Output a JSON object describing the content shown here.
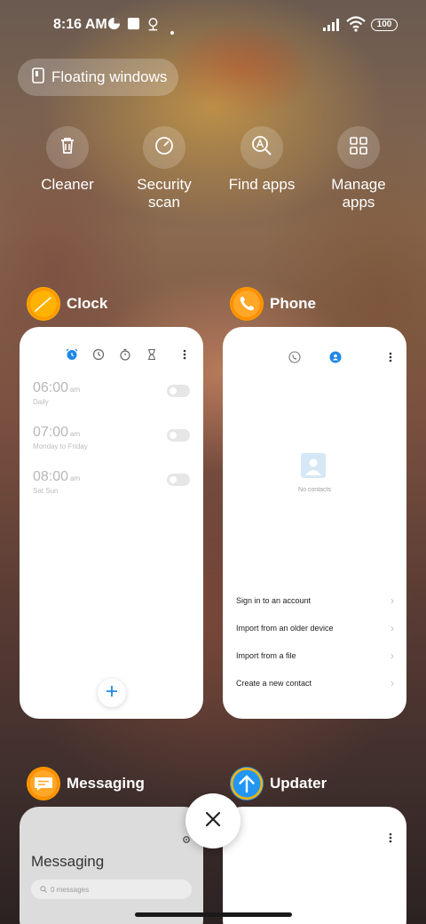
{
  "status_bar": {
    "time": "8:16 AM",
    "battery": "100"
  },
  "floating_windows": {
    "label": "Floating windows",
    "icon": "floating-window-icon"
  },
  "quick_actions": [
    {
      "label": "Cleaner",
      "icon": "trash-icon"
    },
    {
      "label": "Security scan",
      "icon": "security-scan-icon"
    },
    {
      "label": "Find apps",
      "icon": "find-apps-icon"
    },
    {
      "label": "Manage apps",
      "icon": "grid-icon"
    }
  ],
  "recent_apps": [
    {
      "name": "Clock",
      "icon_color": "#ffb300",
      "alarms": [
        {
          "time": "06:00",
          "ampm": "am",
          "repeat": "Daily",
          "enabled": false
        },
        {
          "time": "07:00",
          "ampm": "am",
          "repeat": "Monday to Friday",
          "enabled": false
        },
        {
          "time": "08:00",
          "ampm": "am",
          "repeat": "Sat Sun",
          "enabled": false
        }
      ]
    },
    {
      "name": "Phone",
      "icon_color": "#ffa000",
      "empty_text": "No contacts",
      "options": [
        "Sign in to an account",
        "Import from an older device",
        "Import from a file",
        "Create a new contact"
      ]
    },
    {
      "name": "Messaging",
      "icon_color": "#ffa000",
      "title": "Messaging",
      "search_placeholder": "0 messages"
    },
    {
      "name": "Updater",
      "icon_color": "#2196f3"
    }
  ],
  "colors": {
    "accent": "#1e88e5"
  }
}
